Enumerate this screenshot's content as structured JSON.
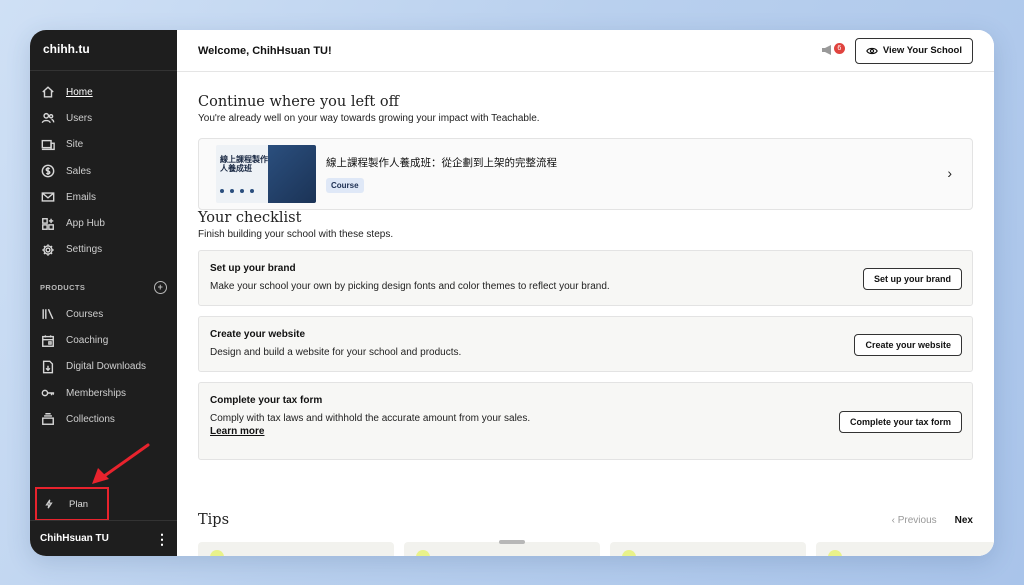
{
  "sidebar": {
    "school_name": "chihh.tu",
    "nav": [
      {
        "label": "Home",
        "icon": "home-icon",
        "active": true
      },
      {
        "label": "Users",
        "icon": "users-icon"
      },
      {
        "label": "Site",
        "icon": "site-icon"
      },
      {
        "label": "Sales",
        "icon": "dollar-icon"
      },
      {
        "label": "Emails",
        "icon": "mail-icon"
      },
      {
        "label": "App Hub",
        "icon": "apps-icon"
      },
      {
        "label": "Settings",
        "icon": "gear-icon"
      }
    ],
    "products_heading": "PRODUCTS",
    "products": [
      {
        "label": "Courses",
        "icon": "courses-icon"
      },
      {
        "label": "Coaching",
        "icon": "calendar-icon"
      },
      {
        "label": "Digital Downloads",
        "icon": "download-icon"
      },
      {
        "label": "Memberships",
        "icon": "key-icon"
      },
      {
        "label": "Collections",
        "icon": "collections-icon"
      }
    ],
    "plan_label": "Plan",
    "user_name": "ChihHsuan TU"
  },
  "topbar": {
    "welcome": "Welcome, ChihHsuan TU!",
    "notification_count": "6",
    "view_school_label": "View Your School"
  },
  "continue": {
    "title": "Continue where you left off",
    "subtitle": "You're already well on your way towards growing your impact with Teachable.",
    "course_title": "線上課程製作人養成班：從企劃到上架的完整流程",
    "course_tag": "Course",
    "thumb_text": "線上課程製作人養成班"
  },
  "checklist": {
    "title": "Your checklist",
    "subtitle": "Finish building your school with these steps.",
    "items": [
      {
        "title": "Set up your brand",
        "desc": "Make your school your own by picking design fonts and color themes to reflect your brand.",
        "button": "Set up your brand"
      },
      {
        "title": "Create your website",
        "desc": "Design and build a website for your school and products.",
        "button": "Create your website"
      },
      {
        "title": "Complete your tax form",
        "desc": "Comply with tax laws and withhold the accurate amount from your sales.",
        "link": "Learn more",
        "button": "Complete your tax form"
      }
    ]
  },
  "tips": {
    "title": "Tips",
    "previous": "‹ Previous",
    "next": "Nex"
  },
  "colors": {
    "sidebar_bg": "#1e1e1e",
    "highlight_red": "#e8232d",
    "badge_red": "#e0433e",
    "tag_bg": "#dfe8f7"
  }
}
